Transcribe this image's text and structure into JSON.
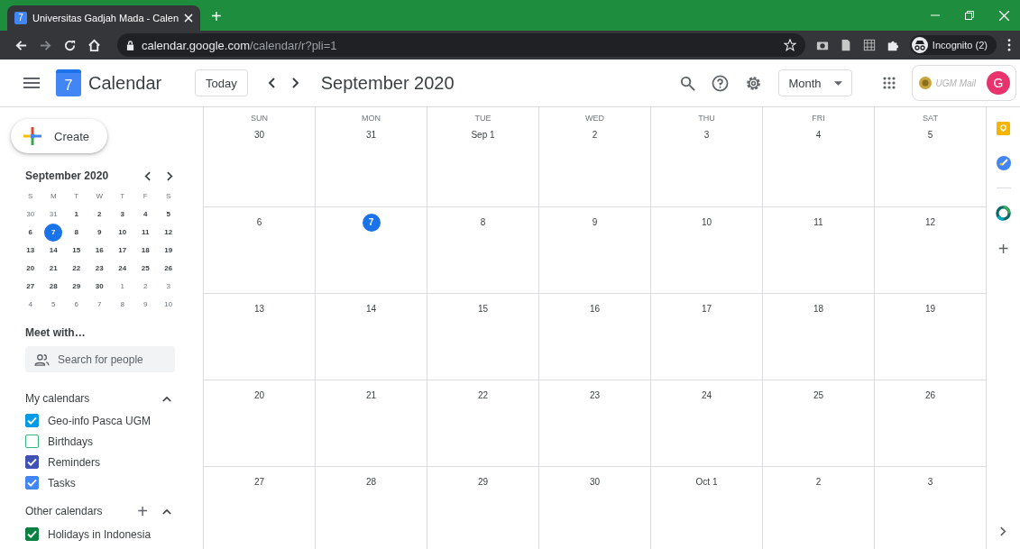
{
  "browser": {
    "tab_title": "Universitas Gadjah Mada - Calen",
    "tab_favicon": "7",
    "new_tab": "+",
    "url_host": "calendar.google.com",
    "url_path": "/calendar/r?pli=1",
    "profile": "Incognito (2)"
  },
  "header": {
    "logo_day": "7",
    "app_name": "Calendar",
    "today_button": "Today",
    "title": "September 2020",
    "view": "Month",
    "account_logo": "UGM Mail",
    "avatar": "G"
  },
  "create_button": "Create",
  "mini_calendar": {
    "title": "September 2020",
    "weekdays": [
      "S",
      "M",
      "T",
      "W",
      "T",
      "F",
      "S"
    ],
    "weeks": [
      [
        {
          "label": "30",
          "muted": true,
          "selected": false
        },
        {
          "label": "31",
          "muted": true,
          "selected": false
        },
        {
          "label": "1",
          "muted": false,
          "selected": false
        },
        {
          "label": "2",
          "muted": false,
          "selected": false
        },
        {
          "label": "3",
          "muted": false,
          "selected": false
        },
        {
          "label": "4",
          "muted": false,
          "selected": false
        },
        {
          "label": "5",
          "muted": false,
          "selected": false
        }
      ],
      [
        {
          "label": "6",
          "muted": false,
          "selected": false
        },
        {
          "label": "7",
          "muted": false,
          "selected": true
        },
        {
          "label": "8",
          "muted": false,
          "selected": false
        },
        {
          "label": "9",
          "muted": false,
          "selected": false
        },
        {
          "label": "10",
          "muted": false,
          "selected": false
        },
        {
          "label": "11",
          "muted": false,
          "selected": false
        },
        {
          "label": "12",
          "muted": false,
          "selected": false
        }
      ],
      [
        {
          "label": "13",
          "muted": false,
          "selected": false
        },
        {
          "label": "14",
          "muted": false,
          "selected": false
        },
        {
          "label": "15",
          "muted": false,
          "selected": false
        },
        {
          "label": "16",
          "muted": false,
          "selected": false
        },
        {
          "label": "17",
          "muted": false,
          "selected": false
        },
        {
          "label": "18",
          "muted": false,
          "selected": false
        },
        {
          "label": "19",
          "muted": false,
          "selected": false
        }
      ],
      [
        {
          "label": "20",
          "muted": false,
          "selected": false
        },
        {
          "label": "21",
          "muted": false,
          "selected": false
        },
        {
          "label": "22",
          "muted": false,
          "selected": false
        },
        {
          "label": "23",
          "muted": false,
          "selected": false
        },
        {
          "label": "24",
          "muted": false,
          "selected": false
        },
        {
          "label": "25",
          "muted": false,
          "selected": false
        },
        {
          "label": "26",
          "muted": false,
          "selected": false
        }
      ],
      [
        {
          "label": "27",
          "muted": false,
          "selected": false
        },
        {
          "label": "28",
          "muted": false,
          "selected": false
        },
        {
          "label": "29",
          "muted": false,
          "selected": false
        },
        {
          "label": "30",
          "muted": false,
          "selected": false
        },
        {
          "label": "1",
          "muted": true,
          "selected": false
        },
        {
          "label": "2",
          "muted": true,
          "selected": false
        },
        {
          "label": "3",
          "muted": true,
          "selected": false
        }
      ],
      [
        {
          "label": "4",
          "muted": true,
          "selected": false
        },
        {
          "label": "5",
          "muted": true,
          "selected": false
        },
        {
          "label": "6",
          "muted": true,
          "selected": false
        },
        {
          "label": "7",
          "muted": true,
          "selected": false
        },
        {
          "label": "8",
          "muted": true,
          "selected": false
        },
        {
          "label": "9",
          "muted": true,
          "selected": false
        },
        {
          "label": "10",
          "muted": true,
          "selected": false
        }
      ]
    ]
  },
  "meet": {
    "title": "Meet with…",
    "placeholder": "Search for people"
  },
  "my_calendars": {
    "title": "My calendars",
    "items": [
      {
        "label": "Geo-info Pasca UGM",
        "checked": true,
        "color": "#039be5"
      },
      {
        "label": "Birthdays",
        "checked": false,
        "color": "#33b679"
      },
      {
        "label": "Reminders",
        "checked": true,
        "color": "#3f51b5"
      },
      {
        "label": "Tasks",
        "checked": true,
        "color": "#4285f4"
      }
    ]
  },
  "other_calendars": {
    "title": "Other calendars",
    "add": "+",
    "items": [
      {
        "label": "Holidays in Indonesia",
        "checked": true,
        "color": "#0b8043"
      }
    ]
  },
  "month_grid": {
    "weekdays": [
      "SUN",
      "MON",
      "TUE",
      "WED",
      "THU",
      "FRI",
      "SAT"
    ],
    "weeks": [
      [
        {
          "label": "30",
          "selected": false
        },
        {
          "label": "31",
          "selected": false
        },
        {
          "label": "Sep 1",
          "selected": false
        },
        {
          "label": "2",
          "selected": false
        },
        {
          "label": "3",
          "selected": false
        },
        {
          "label": "4",
          "selected": false
        },
        {
          "label": "5",
          "selected": false
        }
      ],
      [
        {
          "label": "6",
          "selected": false
        },
        {
          "label": "7",
          "selected": true
        },
        {
          "label": "8",
          "selected": false
        },
        {
          "label": "9",
          "selected": false
        },
        {
          "label": "10",
          "selected": false
        },
        {
          "label": "11",
          "selected": false
        },
        {
          "label": "12",
          "selected": false
        }
      ],
      [
        {
          "label": "13",
          "selected": false
        },
        {
          "label": "14",
          "selected": false
        },
        {
          "label": "15",
          "selected": false
        },
        {
          "label": "16",
          "selected": false
        },
        {
          "label": "17",
          "selected": false
        },
        {
          "label": "18",
          "selected": false
        },
        {
          "label": "19",
          "selected": false
        }
      ],
      [
        {
          "label": "20",
          "selected": false
        },
        {
          "label": "21",
          "selected": false
        },
        {
          "label": "22",
          "selected": false
        },
        {
          "label": "23",
          "selected": false
        },
        {
          "label": "24",
          "selected": false
        },
        {
          "label": "25",
          "selected": false
        },
        {
          "label": "26",
          "selected": false
        }
      ],
      [
        {
          "label": "27",
          "selected": false
        },
        {
          "label": "28",
          "selected": false
        },
        {
          "label": "29",
          "selected": false
        },
        {
          "label": "30",
          "selected": false
        },
        {
          "label": "Oct 1",
          "selected": false
        },
        {
          "label": "2",
          "selected": false
        },
        {
          "label": "3",
          "selected": false
        }
      ]
    ]
  },
  "side_panel": {
    "add": "+"
  }
}
